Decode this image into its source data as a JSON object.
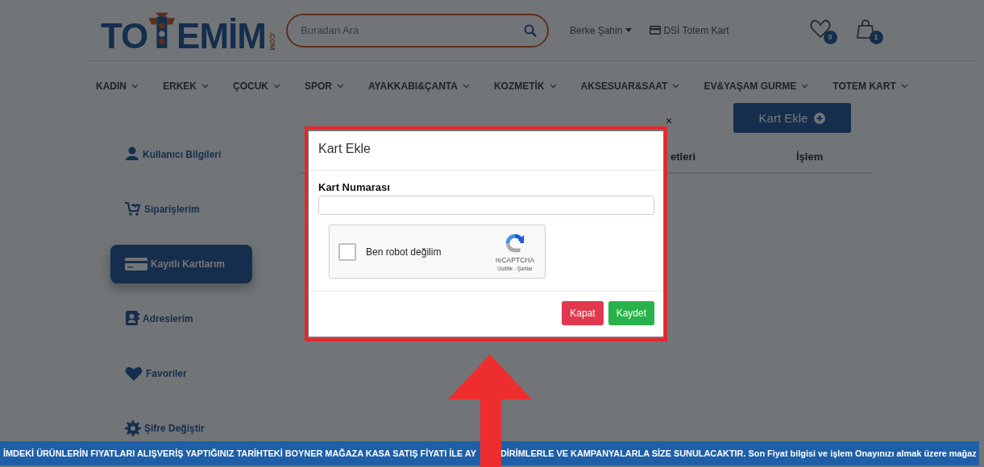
{
  "header": {
    "logo": {
      "left": "TO",
      "right": "EMİM",
      "suffix": ".COM"
    },
    "search": {
      "placeholder": "Buradan Ara"
    },
    "user": "Berke Şahin",
    "card_link": "DSİ Totem Kart",
    "favorites_count": "0",
    "cart_count": "1"
  },
  "nav": [
    {
      "label": "KADIN"
    },
    {
      "label": "ERKEK"
    },
    {
      "label": "ÇOCUK"
    },
    {
      "label": "SPOR"
    },
    {
      "label": "AYAKKABI&ÇANTA"
    },
    {
      "label": "KOZMETİK"
    },
    {
      "label": "AKSESUAR&SAAT"
    },
    {
      "label": "EV&YAŞAM GURME"
    },
    {
      "label": "TOTEM KART"
    }
  ],
  "sidebar": {
    "items": [
      {
        "label": "Kullanıcı Bilgileri",
        "selected": false
      },
      {
        "label": "Siparişlerim",
        "selected": false
      },
      {
        "label": "Kayıtlı Kartlarım",
        "selected": true
      },
      {
        "label": "Adreslerim",
        "selected": false
      },
      {
        "label": "Favoriler",
        "selected": false
      },
      {
        "label": "Şifre Değiştir",
        "selected": false
      }
    ]
  },
  "add_card_button": "Kart Ekle",
  "table": {
    "columns": [
      "etleri",
      "İşlem"
    ]
  },
  "close_mark": "×",
  "modal": {
    "title": "Kart Ekle",
    "field_label": "Kart Numarası",
    "captcha": {
      "label": "Ben robot değilim",
      "checked": false,
      "brand": "reCAPTCHA",
      "links": "Gizlilik - Şartlar"
    },
    "buttons": [
      {
        "label": "Kapat",
        "kind": "danger"
      },
      {
        "label": "Kaydet",
        "kind": "success"
      }
    ]
  },
  "notice": {
    "parts": [
      "İMDEKİ ÜRÜNLERİN FIYATLARI ALIŞVERİŞ YAPTIĞINIZ TARİHTEKİ BOYNER MAĞAZA KASA SATIŞ FİYATI İLE AY",
      "DİRİMLERLE VE KAMPANYALARLA SİZE SUNULACAKTIR. Son Fiyat bilgisi ve işlem Onayınızı almak üzere mağaz"
    ]
  }
}
